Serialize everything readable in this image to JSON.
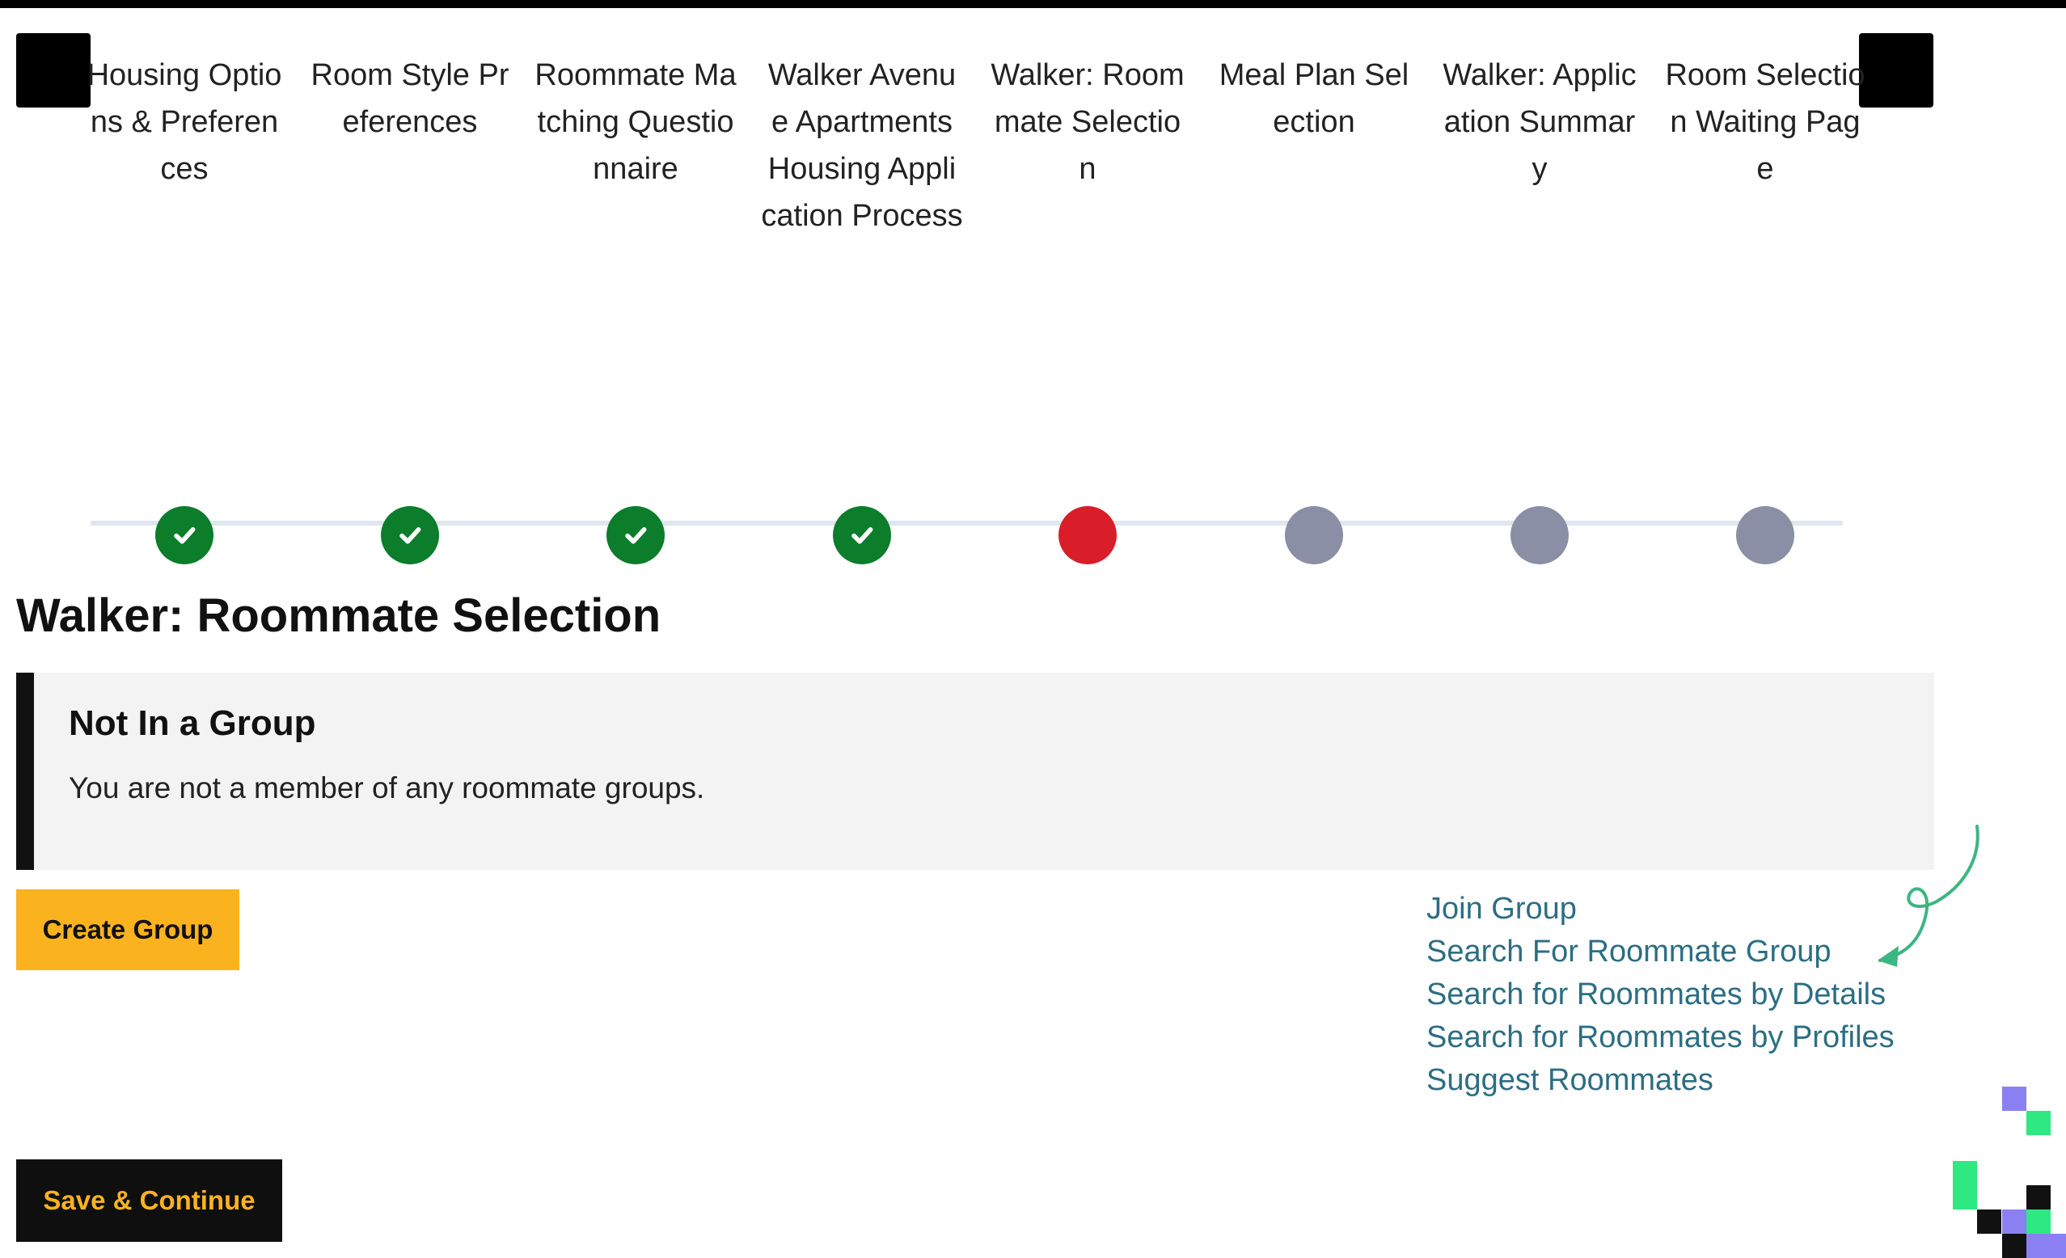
{
  "colors": {
    "completed": "#0b7d2b",
    "current": "#d91e2a",
    "pending": "#8a8fa5",
    "accent": "#fbb21f",
    "link": "#2c6e83",
    "deco_green": "#3cb683"
  },
  "stepper": {
    "prev_icon": "previous-square",
    "next_icon": "next-square",
    "steps": [
      {
        "label": "Housing Options & Preferences",
        "status": "completed"
      },
      {
        "label": "Room Style Preferences",
        "status": "completed"
      },
      {
        "label": "Roommate Matching Questionnaire",
        "status": "completed"
      },
      {
        "label": "Walker Avenue Apartments Housing Application Process",
        "status": "completed"
      },
      {
        "label": "Walker: Roommate Selection",
        "status": "current"
      },
      {
        "label": "Meal Plan Selection",
        "status": "pending"
      },
      {
        "label": "Walker: Application Summary",
        "status": "pending"
      },
      {
        "label": "Room Selection Waiting Page",
        "status": "pending"
      }
    ]
  },
  "page": {
    "title": "Walker: Roommate Selection"
  },
  "notice": {
    "title": "Not In a Group",
    "text": "You are not a member of any roommate groups."
  },
  "buttons": {
    "create_group": "Create Group",
    "save_continue": "Save & Continue"
  },
  "links": [
    "Join Group",
    "Search For Roommate Group",
    "Search for Roommates by Details",
    "Search for Roommates by Profiles",
    "Suggest Roommates"
  ]
}
